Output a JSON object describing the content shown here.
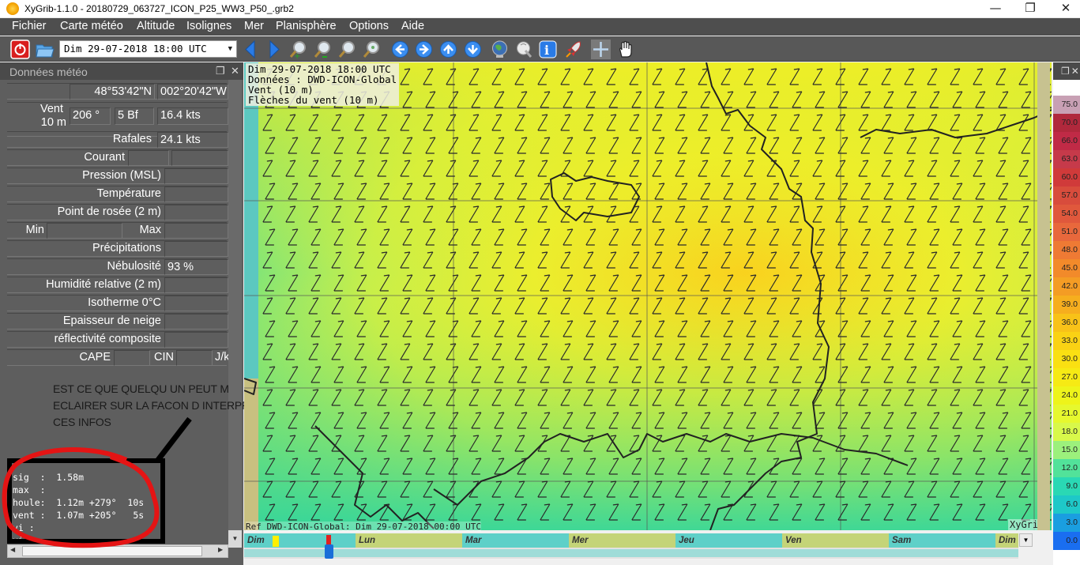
{
  "window": {
    "title": "XyGrib-1.1.0 - 20180729_063727_ICON_P25_WW3_P50_.grb2",
    "minimize": "—",
    "maximize": "❐",
    "close": "✕"
  },
  "menubar": [
    "Fichier",
    "Carte météo",
    "Altitude",
    "Isolignes",
    "Mer",
    "Planisphère",
    "Options",
    "Aide"
  ],
  "toolbar": {
    "date_select": "Dim 29-07-2018 18:00 UTC",
    "icons": [
      "quit-icon",
      "open-file-icon",
      "prev-date-icon",
      "next-date-icon",
      "zoom-in-icon",
      "zoom-out-icon",
      "zoom-fit-icon",
      "zoom-all-icon",
      "pan-left-icon",
      "pan-right-icon",
      "pan-up-icon",
      "pan-down-icon",
      "globe-icon",
      "download-icon",
      "point-info-icon",
      "rocket-icon",
      "crosshair-icon",
      "hand-icon"
    ]
  },
  "dock": {
    "title": "Données météo",
    "lat": "48°53'42\"N",
    "lon": "002°20'42\"W",
    "vent_label": "Vent",
    "vent_sublabel": "10 m",
    "vent_dir": "206 °",
    "vent_bf": "5 Bf",
    "vent_speed": "16.4  kts",
    "rafales_label": "Rafales",
    "rafales_value": "24.1  kts",
    "courant_label": "Courant",
    "pression_label": "Pression (MSL)",
    "temperature_label": "Température",
    "rosee_label": "Point de rosée (2 m)",
    "min_label": "Min",
    "max_label": "Max",
    "precip_label": "Précipitations",
    "nebulosite_label": "Nébulosité",
    "nebulosite_value": "93 %",
    "humidite_label": "Humidité relative (2 m)",
    "isotherme_label": "Isotherme 0°C",
    "neige_label": "Epaisseur de neige",
    "reflect_label": "réflectivité composite",
    "cape_label": "CAPE",
    "cin_label": "CIN",
    "jkg_label": "J/k",
    "wave_lines": "sig  :  1.58m\nmax  :\nhoule:  1.12m +279°  10s\nvent :  1.07m +205°   5s\nvi :\nvi :",
    "comment": [
      "EST CE QUE QUELQU UN PEUT M",
      "ECLAIRER SUR LA FACON D INTERPRETER",
      "CES INFOS"
    ]
  },
  "map": {
    "info_lines": [
      "Dim 29-07-2018 18:00 UTC",
      "Données : DWD-ICON-Global",
      "Vent (10 m)",
      "Flèches du vent (10 m)"
    ],
    "ref": "Ref DWD-ICON-Global: Dim 29-07-2018 00:00 UTC",
    "brand": "XyGrib"
  },
  "timeline": {
    "days": [
      "Dim",
      "Lun",
      "Mar",
      "Mer",
      "Jeu",
      "Ven",
      "Sam",
      "Dim"
    ]
  },
  "colorbar": {
    "values": [
      "75.0",
      "70.0",
      "66.0",
      "63.0",
      "60.0",
      "57.0",
      "54.0",
      "51.0",
      "48.0",
      "45.0",
      "42.0",
      "39.0",
      "36.0",
      "33.0",
      "30.0",
      "27.0",
      "24.0",
      "21.0",
      "18.0",
      "15.0",
      "12.0",
      "9.0",
      "6.0",
      "3.0",
      "0.0"
    ],
    "colors": [
      "#c8a0b4",
      "#b0283c",
      "#c02a46",
      "#c63a4a",
      "#d03a3a",
      "#d84c3c",
      "#e0583c",
      "#e8683c",
      "#ee7a34",
      "#f28a2a",
      "#f49c24",
      "#f6ae1e",
      "#f8c218",
      "#fad214",
      "#fae012",
      "#f6ea14",
      "#eef41a",
      "#e6f82e",
      "#d8f84a",
      "#9cf07c",
      "#52e29a",
      "#2ad8b4",
      "#1ec8c8",
      "#1a9ee0",
      "#1a6ef0"
    ]
  }
}
